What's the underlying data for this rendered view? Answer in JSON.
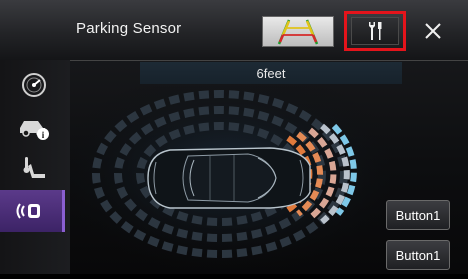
{
  "header": {
    "title": "Parking Sensor"
  },
  "icons": {
    "guide": "parking-guide-lines-icon",
    "settings": "settings-wrench-screwdriver-icon",
    "close": "close-icon",
    "gauge": "gauge-icon",
    "car_info": "car-info-icon",
    "seat_heat": "seat-temperature-icon",
    "parking_sensor": "parking-sensor-icon"
  },
  "sensor": {
    "distance_label": "6feet"
  },
  "buttons": {
    "button_1": "Button1",
    "button_2": "Button1"
  },
  "colors": {
    "highlight": "#e4141b",
    "active_sidebar": "#5b3a8a",
    "sensor_far": "#7ec8e8",
    "sensor_near": "#e07a3c"
  }
}
